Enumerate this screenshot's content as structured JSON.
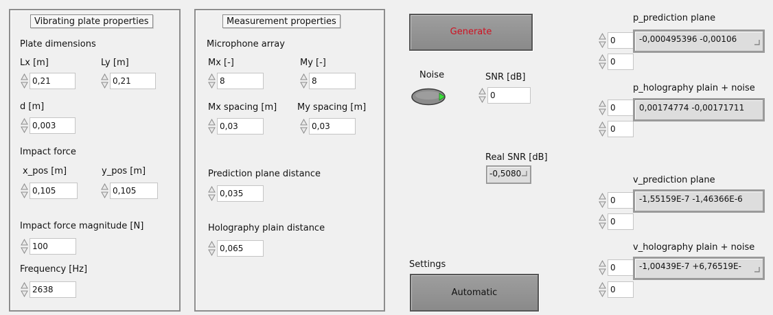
{
  "vibrating_panel": {
    "title": "Vibrating plate properties",
    "plate_dimensions_label": "Plate dimensions",
    "lx": {
      "label": "Lx [m]",
      "value": "0,21"
    },
    "ly": {
      "label": "Ly [m]",
      "value": "0,21"
    },
    "d": {
      "label": "d [m]",
      "value": "0,003"
    },
    "impact_force_label": "Impact force",
    "x_pos": {
      "label": "x_pos [m]",
      "value": "0,105"
    },
    "y_pos": {
      "label": "y_pos [m]",
      "value": "0,105"
    },
    "magnitude": {
      "label": "Impact force magnitude [N]",
      "value": "100"
    },
    "frequency": {
      "label": "Frequency [Hz]",
      "value": "2638"
    }
  },
  "measurement_panel": {
    "title": "Measurement properties",
    "microphone_array_label": "Microphone array",
    "mx": {
      "label": "Mx [-]",
      "value": "8"
    },
    "my": {
      "label": "My [-]",
      "value": "8"
    },
    "mx_spacing": {
      "label": "Mx spacing [m]",
      "value": "0,03"
    },
    "my_spacing": {
      "label": "My spacing [m]",
      "value": "0,03"
    },
    "prediction_distance": {
      "label": "Prediction plane distance",
      "value": "0,035"
    },
    "holography_distance": {
      "label": "Holography plain distance",
      "value": "0,065"
    }
  },
  "controls": {
    "generate_label": "Generate",
    "noise_label": "Noise",
    "snr": {
      "label": "SNR [dB]",
      "value": "0"
    },
    "real_snr": {
      "label": "Real SNR [dB]",
      "value": "-0,5080"
    },
    "settings_label": "Settings",
    "automatic_label": "Automatic"
  },
  "arrays": {
    "p_prediction": {
      "label": "p_prediction plane",
      "index0": "0",
      "index1": "0",
      "value": "-0,000495396 -0,00106"
    },
    "p_holography": {
      "label": "p_holography plain + noise",
      "index0": "0",
      "index1": "0",
      "value": "0,00174774 -0,00171711"
    },
    "v_prediction": {
      "label": "v_prediction plane",
      "index0": "0",
      "index1": "0",
      "value": "-1,55159E-7 -1,46366E-6"
    },
    "v_holography": {
      "label": "v_holography plain + noise",
      "index0": "0",
      "index1": "0",
      "value": "-1,00439E-7 +6,76519E-"
    }
  },
  "icons": [
    "spinner-arrows-icon",
    "cursor-corner-icon",
    "led-icon"
  ],
  "colors": {
    "generate_text": "#d01020",
    "led_green": "#3ee03e",
    "button_gray": "#8f8f8f"
  }
}
